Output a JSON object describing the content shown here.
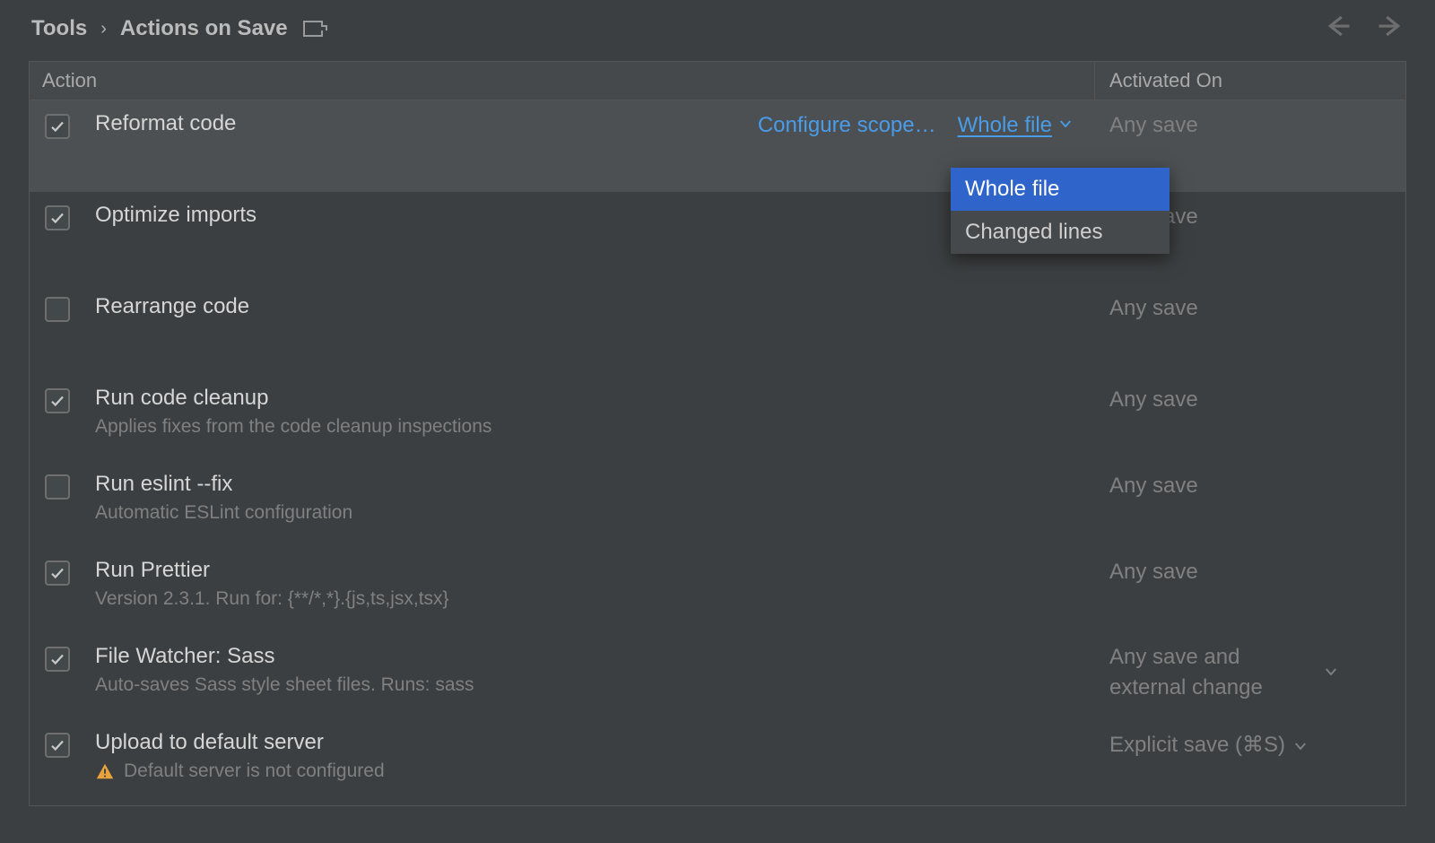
{
  "breadcrumb": {
    "root": "Tools",
    "title": "Actions on Save"
  },
  "columns": {
    "action": "Action",
    "activated": "Activated On"
  },
  "rows": [
    {
      "checked": true,
      "label": "Reformat code",
      "sub": "",
      "highlight": true,
      "configure": "Configure scope…",
      "scope": "Whole file",
      "activated": "Any save",
      "activated_chev": false
    },
    {
      "checked": true,
      "label": "Optimize imports",
      "sub": "",
      "activated": "Any save"
    },
    {
      "checked": false,
      "label": "Rearrange code",
      "sub": "",
      "activated": "Any save"
    },
    {
      "checked": true,
      "label": "Run code cleanup",
      "sub": "Applies fixes from the code cleanup inspections",
      "activated": "Any save"
    },
    {
      "checked": false,
      "label": "Run eslint --fix",
      "sub": "Automatic ESLint configuration",
      "activated": "Any save"
    },
    {
      "checked": true,
      "label": "Run Prettier",
      "sub": "Version 2.3.1. Run for: {**/*,*}.{js,ts,jsx,tsx}",
      "activated": "Any save"
    },
    {
      "checked": true,
      "label": "File Watcher: Sass",
      "sub": "Auto-saves Sass style sheet files. Runs: sass",
      "activated": "Any save and external change",
      "activated_chev": true
    },
    {
      "checked": true,
      "label": "Upload to default server",
      "sub": "Default server is not configured",
      "warn": true,
      "activated": "Explicit save (⌘S)",
      "activated_chev": true
    }
  ],
  "dropdown": {
    "items": [
      "Whole file",
      "Changed lines"
    ],
    "selected": 0
  }
}
